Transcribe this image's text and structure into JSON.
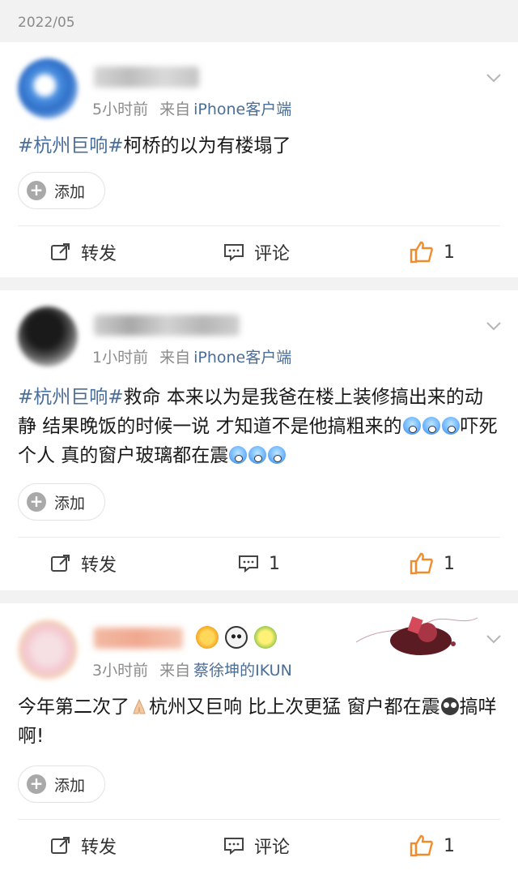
{
  "date_header": "2022/05",
  "posts": [
    {
      "time": "5小时前",
      "from_label": "来自",
      "client": "iPhone客户端",
      "hashtag": "#杭州巨响#",
      "text": "柯桥的以为有楼塌了",
      "add_label": "添加",
      "repost_label": "转发",
      "comment_label": "评论",
      "like_count": "1"
    },
    {
      "time": "1小时前",
      "from_label": "来自",
      "client": "iPhone客户端",
      "hashtag": "#杭州巨响#",
      "text_1": "救命 本来以为是我爸在楼上装修搞出来的动静 结果晚饭的时候一说 才知道不是他搞粗来的",
      "text_2": "吓死个人 真的窗户玻璃都在震",
      "add_label": "添加",
      "repost_label": "转发",
      "comment_count": "1",
      "like_count": "1"
    },
    {
      "time": "3小时前",
      "from_label": "来自",
      "client": "蔡徐坤的IKUN",
      "text_1": "今年第二次了",
      "text_2": "杭州又巨响 比上次更猛 窗户都在震",
      "text_3": "搞咩啊!",
      "add_label": "添加",
      "repost_label": "转发",
      "comment_label": "评论",
      "like_count": "1"
    }
  ],
  "colors": {
    "link": "#4a6e9a",
    "like": "#f08c2a",
    "meta": "#8c8c8c"
  }
}
